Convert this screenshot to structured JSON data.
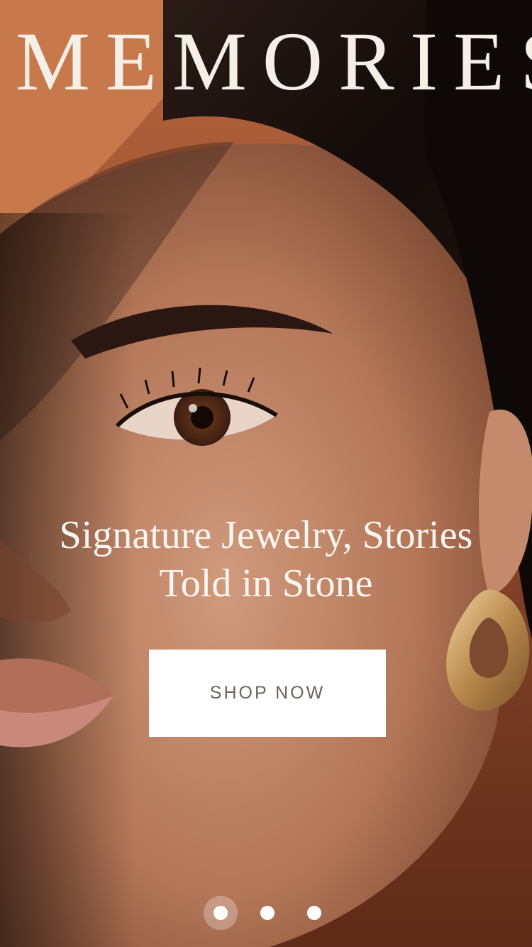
{
  "brand": {
    "logo_text": "MEMORIES"
  },
  "hero": {
    "headline_line1": "Signature Jewelry, Stories",
    "headline_line2": "Told in Stone",
    "cta_label": "SHOP NOW"
  },
  "carousel": {
    "slide_count": 3,
    "active_index": 0
  },
  "colors": {
    "logo_text": "#f6efe8",
    "headline_text": "#fbf6f1",
    "button_bg": "#ffffff",
    "button_text": "#6e645e",
    "dot": "#ffffff"
  }
}
